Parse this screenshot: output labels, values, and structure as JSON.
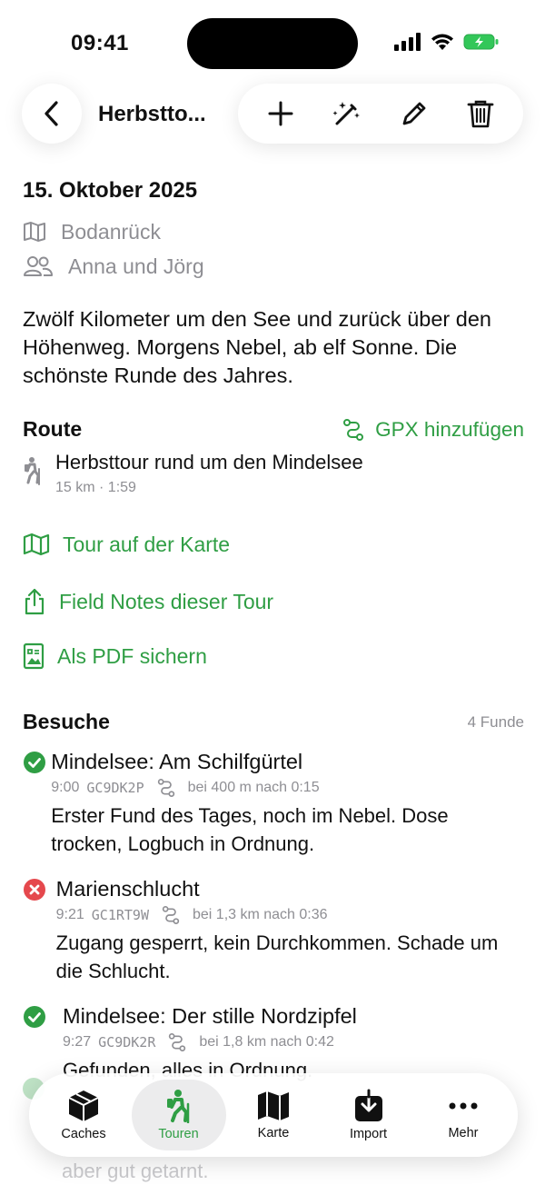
{
  "status_bar": {
    "time": "09:41"
  },
  "nav": {
    "title": "Herbstto..."
  },
  "tour": {
    "date": "15. Oktober 2025",
    "area": "Bodanrück",
    "people": "Anna und Jörg",
    "description": "Zwölf Kilometer um den See und zurück über den Höhenweg. Morgens Nebel, ab elf Sonne. Die schönste Runde des Jahres."
  },
  "route": {
    "section_title": "Route",
    "gpx_link": "GPX hinzufügen",
    "name": "Herbsttour rund um den Mindelsee",
    "stats": "15 km · 1:59"
  },
  "actions": {
    "map": "Tour auf der Karte",
    "field_notes": "Field Notes dieser Tour",
    "pdf": "Als PDF sichern"
  },
  "visits": {
    "section_title": "Besuche",
    "count": "4 Funde",
    "items": [
      {
        "status": "found",
        "title": "Mindelsee: Am Schilfgürtel",
        "time": "9:00",
        "code": "GC9DK2P",
        "distance": "bei 400 m nach 0:15",
        "note": "Erster Fund des Tages, noch im Nebel. Dose trocken, Logbuch in Ordnung."
      },
      {
        "status": "dnf",
        "title": "Marienschlucht",
        "time": "9:21",
        "code": "GC1RT9W",
        "distance": "bei 1,3 km nach 0:36",
        "note": "Zugang gesperrt, kein Durchkommen. Schade um die Schlucht."
      },
      {
        "status": "found",
        "title": "Mindelsee: Der stille Nordzipfel",
        "time": "9:27",
        "code": "GC9DK2R",
        "distance": "bei 1,8 km nach 0:42",
        "note": "Gefunden, alles in Ordnung."
      }
    ],
    "overflow_text": "aber gut getarnt."
  },
  "tabbar": {
    "tabs": [
      {
        "label": "Caches",
        "icon": "cube-icon"
      },
      {
        "label": "Touren",
        "icon": "hiker-icon",
        "active": true
      },
      {
        "label": "Karte",
        "icon": "map-icon"
      },
      {
        "label": "Import",
        "icon": "tray-download-icon"
      },
      {
        "label": "Mehr",
        "icon": "ellipsis-icon"
      }
    ]
  },
  "colors": {
    "accent": "#2f9e44",
    "danger": "#e5484d",
    "secondary_text": "#8e8e93"
  }
}
